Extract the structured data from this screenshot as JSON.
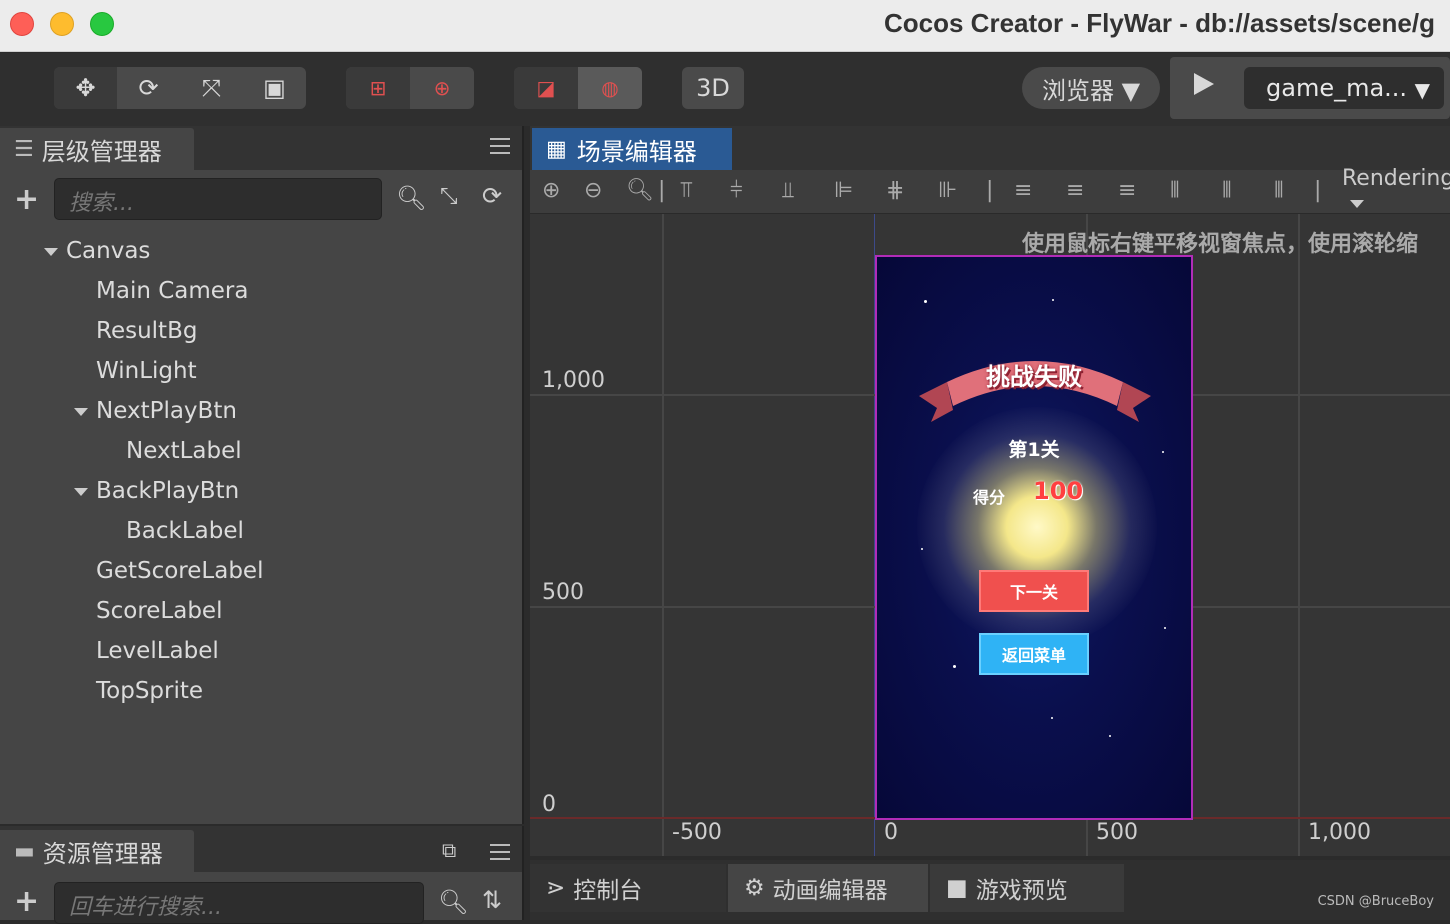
{
  "window": {
    "title": "Cocos Creator - FlyWar - db://assets/scene/g"
  },
  "toolbar": {
    "transform_icons": [
      "move-icon",
      "rotate-icon",
      "scale-icon",
      "rect-icon"
    ],
    "pivot_icons": [
      "pivot-icon",
      "center-icon"
    ],
    "coord_icons": [
      "local-coord-icon",
      "global-coord-icon"
    ],
    "mode_3d": "3D",
    "browser": "浏览器 ▼",
    "scene_select": "game_ma...",
    "scene_select_arrow": "▼"
  },
  "hierarchy": {
    "tab": "层级管理器",
    "search_placeholder": "搜索...",
    "nodes": [
      {
        "label": "Canvas"
      },
      {
        "label": "Main Camera"
      },
      {
        "label": "ResultBg"
      },
      {
        "label": "WinLight"
      },
      {
        "label": "NextPlayBtn"
      },
      {
        "label": "NextLabel"
      },
      {
        "label": "BackPlayBtn"
      },
      {
        "label": "BackLabel"
      },
      {
        "label": "GetScoreLabel"
      },
      {
        "label": "ScoreLabel"
      },
      {
        "label": "LevelLabel"
      },
      {
        "label": "TopSprite"
      }
    ]
  },
  "assets": {
    "tab": "资源管理器",
    "search_placeholder": "回车进行搜索..."
  },
  "scene": {
    "tab": "场景编辑器",
    "rendering": "Rendering",
    "hint": "使用鼠标右键平移视窗焦点，使用滚轮缩",
    "y_labels": [
      "1,000",
      "500",
      "0"
    ],
    "x_labels": [
      "-500",
      "0",
      "500",
      "1,000"
    ]
  },
  "game": {
    "title": "挑战失败",
    "level": "第1关",
    "score_label": "得分",
    "score_value": "100",
    "next_button": "下一关",
    "back_button": "返回菜单"
  },
  "bottom_tabs": [
    "控制台",
    "动画编辑器",
    "游戏预览"
  ],
  "watermark": "CSDN @BruceBoy",
  "colors": {
    "scene_tab": "#2a5a94",
    "canvas_border": "#b22cb8",
    "next_btn": "#f0504e",
    "back_btn": "#2fb3f5"
  }
}
